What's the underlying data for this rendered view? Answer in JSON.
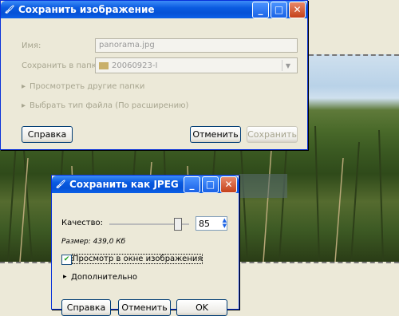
{
  "save_dialog": {
    "title": "Сохранить изображение",
    "name_label": "Имя:",
    "name_value": "panorama.jpg",
    "folder_label": "Сохранить в папке",
    "folder_value": "20060923-I",
    "browse_label": "Просмотреть другие папки",
    "filetype_label": "Выбрать тип файла (По расширению)",
    "help": "Справка",
    "cancel": "Отменить",
    "save": "Сохранить"
  },
  "jpeg_dialog": {
    "title": "Сохранить как JPEG",
    "quality_label": "Качество:",
    "quality_value": "85",
    "quality_fraction": 0.85,
    "size_text": "Размер: 439,0 Кб",
    "preview_label": "Просмотр в окне изображения",
    "advanced_label": "Дополнительно",
    "help": "Справка",
    "cancel": "Отменить",
    "ok": "OK"
  }
}
